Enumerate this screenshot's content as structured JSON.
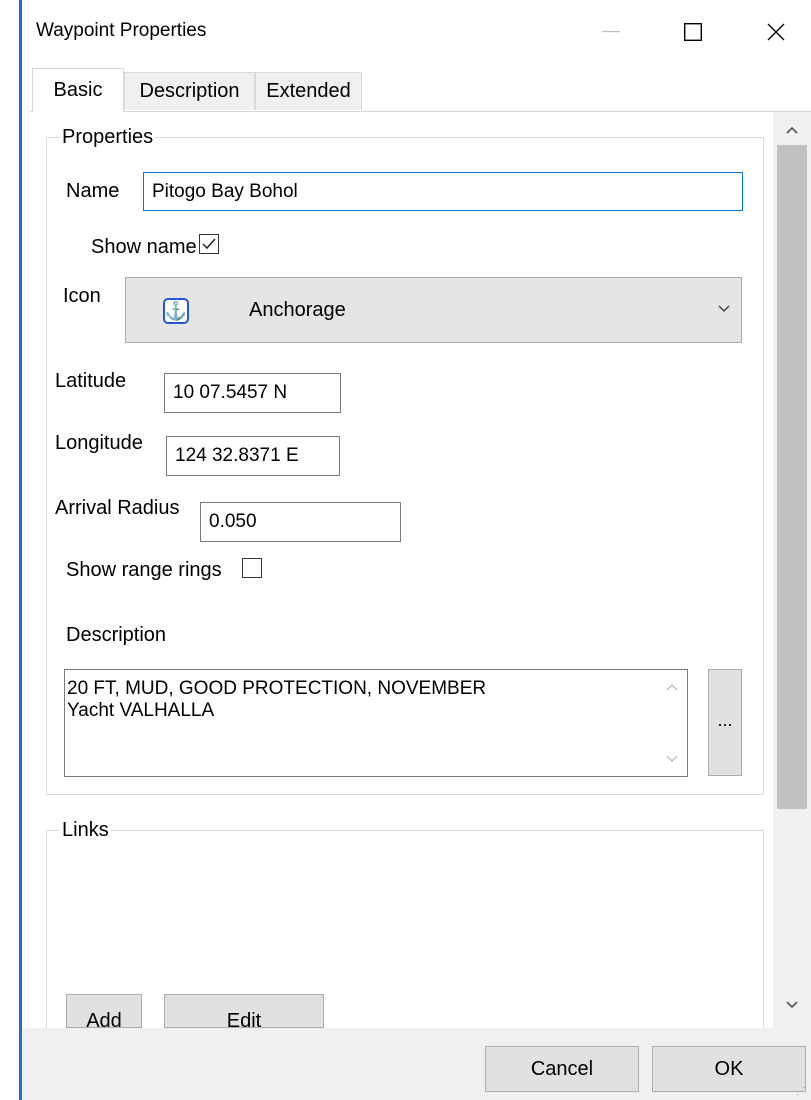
{
  "window": {
    "title": "Waypoint Properties",
    "minimize_icon": "minimize-icon",
    "maximize_icon": "maximize-icon",
    "close_icon": "close-icon",
    "accent_color": "#1f6fc5"
  },
  "tabs": [
    {
      "label": "Basic",
      "active": true
    },
    {
      "label": "Description",
      "active": false
    },
    {
      "label": "Extended",
      "active": false
    }
  ],
  "properties": {
    "legend": "Properties",
    "name_label": "Name",
    "name_value": "Pitogo Bay Bohol",
    "show_name_label": "Show name",
    "show_name_checked": true,
    "icon_label": "Icon",
    "icon_selected": "Anchorage",
    "icon_glyph": "anchor-icon",
    "latitude_label": "Latitude",
    "latitude_value": "10 07.5457 N",
    "longitude_label": "Longitude",
    "longitude_value": "124 32.8371 E",
    "arrival_radius_label": "Arrival Radius",
    "arrival_radius_value": "0.050",
    "show_range_rings_label": "Show range rings",
    "show_range_rings_checked": false,
    "description_label": "Description",
    "description_value": "20 FT, MUD, GOOD PROTECTION, NOVEMBER\nYacht VALHALLA",
    "description_more_button": "..."
  },
  "links": {
    "legend": "Links",
    "add_button": "Add",
    "edit_button": "Edit"
  },
  "footer": {
    "cancel_button": "Cancel",
    "ok_button": "OK"
  }
}
